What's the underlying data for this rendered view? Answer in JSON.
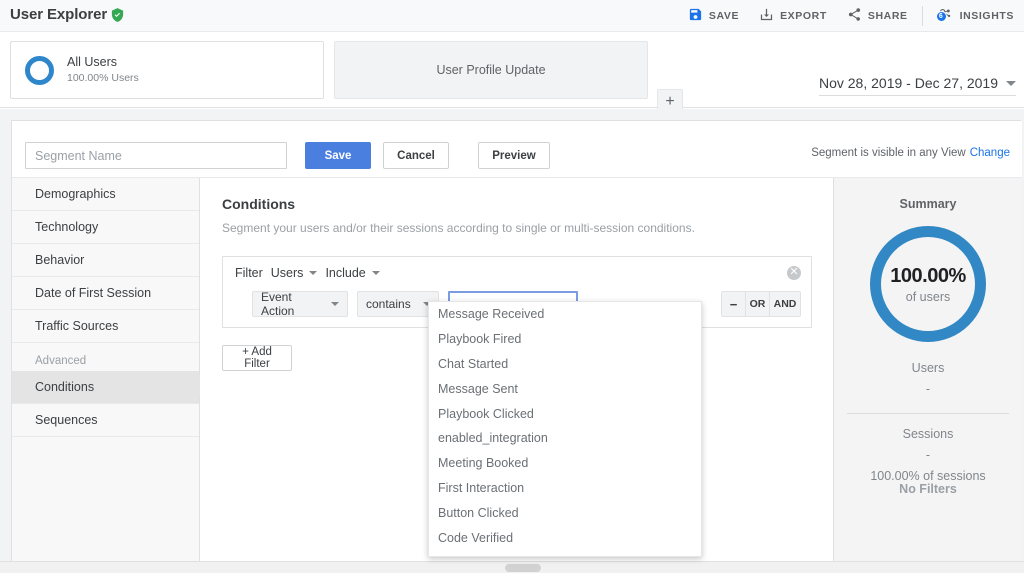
{
  "header": {
    "title": "User Explorer",
    "verified_icon": "verified-shield-icon",
    "toolbar": [
      {
        "label": "SAVE",
        "icon": "save-icon"
      },
      {
        "label": "EXPORT",
        "icon": "export-download-icon"
      },
      {
        "label": "SHARE",
        "icon": "share-icon"
      },
      {
        "label": "INSIGHTS",
        "icon": "insights-icon",
        "badge": "6"
      }
    ]
  },
  "segments": {
    "all_users": {
      "name": "All Users",
      "subtitle": "100.00% Users"
    },
    "second": {
      "name": "User Profile Update"
    },
    "add_label": "+"
  },
  "date_range": {
    "value": "Nov 28, 2019 - Dec 27, 2019"
  },
  "segment_editor": {
    "name_placeholder": "Segment Name",
    "name_value": "",
    "save_label": "Save",
    "cancel_label": "Cancel",
    "preview_label": "Preview",
    "visibility_text": "Segment is visible in any View",
    "change_label": "Change"
  },
  "nav": {
    "items": [
      {
        "label": "Demographics",
        "selected": false
      },
      {
        "label": "Technology",
        "selected": false
      },
      {
        "label": "Behavior",
        "selected": false
      },
      {
        "label": "Date of First Session",
        "selected": false
      },
      {
        "label": "Traffic Sources",
        "selected": false
      }
    ],
    "group_label": "Advanced",
    "advanced_items": [
      {
        "label": "Conditions",
        "selected": true
      },
      {
        "label": "Sequences",
        "selected": false
      }
    ]
  },
  "conditions": {
    "title": "Conditions",
    "description": "Segment your users and/or their sessions according to single or multi-session conditions.",
    "filter": {
      "filter_label": "Filter",
      "scope": "Users",
      "mode": "Include",
      "dimension": "Event Action",
      "operator": "contains",
      "value": "",
      "minus_label": "−",
      "or_label": "OR",
      "and_label": "AND",
      "close_icon": "close-circle-icon"
    },
    "add_filter_label": "+ Add Filter"
  },
  "autocomplete": {
    "options": [
      "Message Received",
      "Playbook Fired",
      "Chat Started",
      "Message Sent",
      "Playbook Clicked",
      "enabled_integration",
      "Meeting Booked",
      "First Interaction",
      "Button Clicked",
      "Code Verified"
    ]
  },
  "summary": {
    "title": "Summary",
    "percent": "100.00%",
    "percent_sub": "of users",
    "users_label": "Users",
    "users_value": "-",
    "sessions_label": "Sessions",
    "sessions_value": "-",
    "sessions_sub": "100.00% of sessions",
    "no_filters": "No Filters",
    "accent_color": "#3288c4"
  }
}
